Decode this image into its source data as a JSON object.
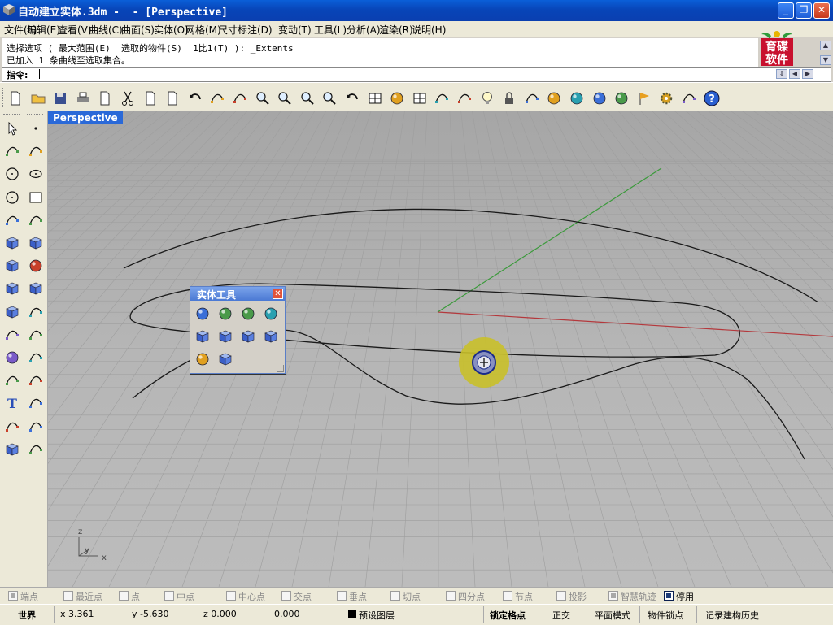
{
  "window": {
    "title": "自动建立实体.3dm -  - [Perspective]",
    "controls": {
      "minimize": "_",
      "maximize": "❐",
      "close": "✕"
    }
  },
  "menubar": {
    "items": [
      "文件(F)",
      "编辑(E)",
      "查看(V)",
      "曲线(C)",
      "曲面(S)",
      "实体(O)",
      "网格(M)",
      "尺寸标注(D)",
      "变动(T)",
      "工具(L)",
      "分析(A)",
      "渲染(R)",
      "说明(H)"
    ]
  },
  "command_history": {
    "lines": [
      "选择选项 ( 最大范围(E)  选取的物件(S)  1比1(T) ): _Extents",
      "已加入 1 条曲线至选取集合。"
    ]
  },
  "command_prompt": {
    "label": "指令:",
    "value": ""
  },
  "logo": {
    "text": "育碟软件",
    "colors": {
      "bg": "#c8102e",
      "leaf": "#2e9b3a"
    }
  },
  "toolbar": {
    "icons": [
      "new-file-icon",
      "open-folder-icon",
      "save-icon",
      "print-icon",
      "import-icon",
      "cut-icon",
      "copy-icon",
      "paste-icon",
      "undo-icon",
      "pan-hand-icon",
      "rotate-view-icon",
      "zoom-icon",
      "zoom-window-icon",
      "zoom-extents-icon",
      "zoom-selected-icon",
      "undo-view-icon",
      "four-viewports-icon",
      "car-render-icon",
      "grid-plane-icon",
      "cplane-icon",
      "point-snap-icon",
      "light-bulb-icon",
      "lock-icon",
      "layers-icon",
      "color-wheel-icon",
      "shade-icon",
      "wireframe-sphere-icon",
      "render-sphere-icon",
      "flag-icon",
      "settings-gear-icon",
      "options-icon",
      "help-icon"
    ]
  },
  "left_tools": {
    "icons": [
      "select-arrow-icon",
      "point-icon",
      "polyline-icon",
      "curve-control-points-icon",
      "circle-icon",
      "ellipse-icon",
      "arc-icon",
      "rectangle-icon",
      "polygon-icon",
      "fillet-curve-icon",
      "surface-icon",
      "loft-surface-icon",
      "box-solid-icon",
      "sphere-solid-icon",
      "cylinder-solid-icon",
      "patch-surface-icon",
      "mesh-tools-icon",
      "explode-icon",
      "split-icon",
      "trim-icon",
      "boolean-icon",
      "group-icon",
      "curve-edit-icon",
      "rebuild-icon",
      "text-icon",
      "dimension-icon",
      "array-icon",
      "scale-icon",
      "solid-box-icon",
      "ruler-icon"
    ]
  },
  "viewport": {
    "label": "Perspective",
    "axis_labels": {
      "z": "z",
      "y": "y",
      "x": "x"
    },
    "colors": {
      "x_axis": "#b4383c",
      "y_axis": "#3a9a3a",
      "curve": "#1a1a1a",
      "cursor_ring": "#c9c02a"
    }
  },
  "solid_tools_panel": {
    "title": "实体工具",
    "close_label": "✕",
    "icons": [
      "boolean-union-icon",
      "boolean-difference-icon",
      "boolean-intersection-icon",
      "boolean-split-icon",
      "cap-planar-holes-icon",
      "extract-surface-icon",
      "merge-faces-icon",
      "solid-edit-icon",
      "solid-face-icon",
      "solid-box-edit-icon"
    ]
  },
  "osnap": {
    "items": [
      {
        "label": "端点",
        "checked": true,
        "enabled": false
      },
      {
        "label": "最近点",
        "checked": false,
        "enabled": false
      },
      {
        "label": "点",
        "checked": false,
        "enabled": false
      },
      {
        "label": "中点",
        "checked": false,
        "enabled": false
      },
      {
        "label": "中心点",
        "checked": false,
        "enabled": false
      },
      {
        "label": "交点",
        "checked": false,
        "enabled": false
      },
      {
        "label": "垂点",
        "checked": false,
        "enabled": false
      },
      {
        "label": "切点",
        "checked": false,
        "enabled": false
      },
      {
        "label": "四分点",
        "checked": false,
        "enabled": false
      },
      {
        "label": "节点",
        "checked": false,
        "enabled": false
      },
      {
        "label": "投影",
        "checked": false,
        "enabled": false
      },
      {
        "label": "智慧轨迹",
        "checked": true,
        "enabled": false
      },
      {
        "label": "停用",
        "checked": true,
        "enabled": true
      }
    ]
  },
  "status": {
    "cplane": "世界",
    "x": "x 3.361",
    "y": "y -5.630",
    "z": "z 0.000",
    "distance": "0.000",
    "layer": "预设图层",
    "layer_color": "#000000",
    "snap": "锁定格点",
    "ortho": "正交",
    "planar": "平面模式",
    "osnap": "物件锁点",
    "history": "记录建构历史"
  }
}
